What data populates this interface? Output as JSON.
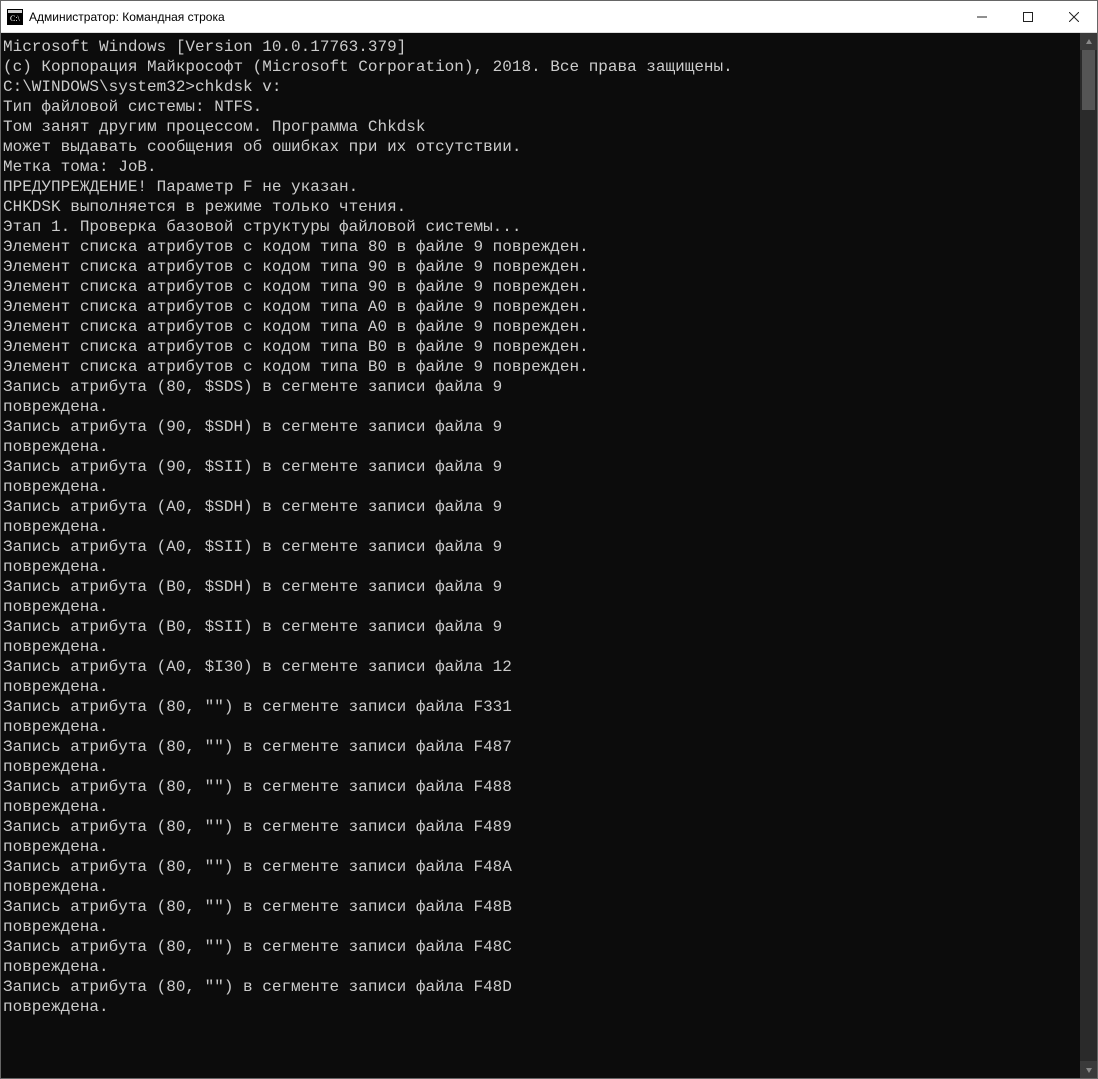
{
  "window": {
    "title": "Администратор: Командная строка"
  },
  "terminal": {
    "lines": [
      "Microsoft Windows [Version 10.0.17763.379]",
      "(c) Корпорация Майкрософт (Microsoft Corporation), 2018. Все права защищены.",
      "",
      "C:\\WINDOWS\\system32>chkdsk v:",
      "Тип файловой системы: NTFS.",
      "Том занят другим процессом. Программа Chkdsk",
      "может выдавать сообщения об ошибках при их отсутствии.",
      "Метка тома: JoB.",
      "",
      "ПРЕДУПРЕЖДЕНИЕ! Параметр F не указан.",
      "CHKDSK выполняется в режиме только чтения.",
      "",
      "Этап 1. Проверка базовой структуры файловой системы...",
      "Элемент списка атрибутов с кодом типа 80 в файле 9 поврежден.",
      "Элемент списка атрибутов с кодом типа 90 в файле 9 поврежден.",
      "Элемент списка атрибутов с кодом типа 90 в файле 9 поврежден.",
      "Элемент списка атрибутов с кодом типа A0 в файле 9 поврежден.",
      "Элемент списка атрибутов с кодом типа A0 в файле 9 поврежден.",
      "Элемент списка атрибутов с кодом типа B0 в файле 9 поврежден.",
      "Элемент списка атрибутов с кодом типа B0 в файле 9 поврежден.",
      "Запись атрибута (80, $SDS) в сегменте записи файла 9",
      "повреждена.",
      "Запись атрибута (90, $SDH) в сегменте записи файла 9",
      "повреждена.",
      "Запись атрибута (90, $SII) в сегменте записи файла 9",
      "повреждена.",
      "Запись атрибута (A0, $SDH) в сегменте записи файла 9",
      "повреждена.",
      "Запись атрибута (A0, $SII) в сегменте записи файла 9",
      "повреждена.",
      "Запись атрибута (B0, $SDH) в сегменте записи файла 9",
      "повреждена.",
      "Запись атрибута (B0, $SII) в сегменте записи файла 9",
      "повреждена.",
      "Запись атрибута (A0, $I30) в сегменте записи файла 12",
      "повреждена.",
      "Запись атрибута (80, \"\") в сегменте записи файла F331",
      "повреждена.",
      "Запись атрибута (80, \"\") в сегменте записи файла F487",
      "повреждена.",
      "Запись атрибута (80, \"\") в сегменте записи файла F488",
      "повреждена.",
      "Запись атрибута (80, \"\") в сегменте записи файла F489",
      "повреждена.",
      "Запись атрибута (80, \"\") в сегменте записи файла F48A",
      "повреждена.",
      "Запись атрибута (80, \"\") в сегменте записи файла F48B",
      "повреждена.",
      "Запись атрибута (80, \"\") в сегменте записи файла F48C",
      "повреждена.",
      "Запись атрибута (80, \"\") в сегменте записи файла F48D",
      "повреждена."
    ]
  }
}
